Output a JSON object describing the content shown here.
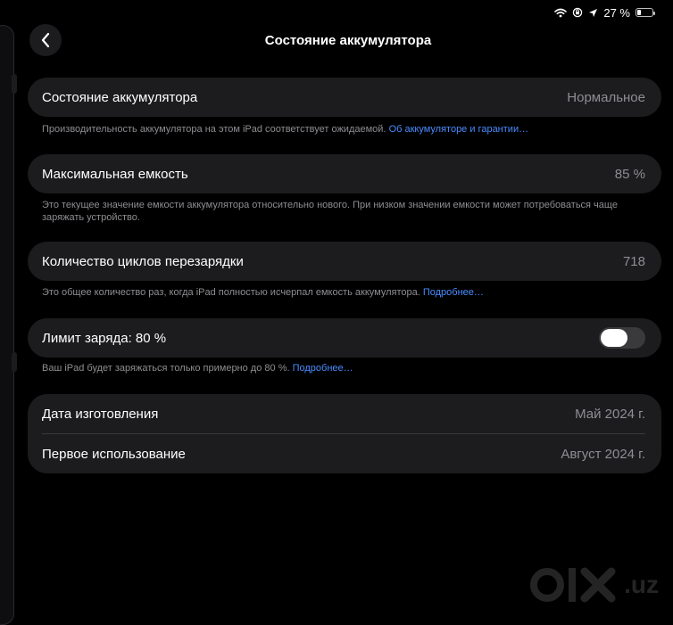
{
  "status_bar": {
    "battery_percent": "27 %",
    "battery_level": 0.27
  },
  "header": {
    "title": "Состояние аккумулятора"
  },
  "battery_health": {
    "label": "Состояние аккумулятора",
    "value": "Нормальное",
    "note": "Производительность аккумулятора на этом iPad соответствует ожидаемой.",
    "link": "Об аккумуляторе и гарантии…"
  },
  "max_capacity": {
    "label": "Максимальная емкость",
    "value": "85 %",
    "note": "Это текущее значение емкости аккумулятора относительно нового. При низком значении емкости может потребоваться чаще заряжать устройство."
  },
  "cycle_count": {
    "label": "Количество циклов перезарядки",
    "value": "718",
    "note": "Это общее количество раз, когда iPad полностью исчерпал емкость аккумулятора.",
    "link": "Подробнее…"
  },
  "charge_limit": {
    "label": "Лимит заряда: 80 %",
    "enabled": false,
    "note": "Ваш iPad будет заряжаться только примерно до 80 %.",
    "link": "Подробнее…"
  },
  "dates": {
    "manufacture_label": "Дата изготовления",
    "manufacture_value": "Май 2024 г.",
    "first_use_label": "Первое использование",
    "first_use_value": "Август 2024 г."
  },
  "colors": {
    "background": "#000000",
    "card": "#1c1c1e",
    "link": "#4a8cff",
    "secondary": "#8e8e93"
  },
  "icons": {
    "back": "chevron-left-icon",
    "wifi": "wifi-icon",
    "orientation_lock": "orientation-lock-icon",
    "location": "location-arrow-icon",
    "battery": "battery-icon"
  },
  "watermark": {
    "logo": "olx-logo",
    "suffix": ".uz"
  }
}
